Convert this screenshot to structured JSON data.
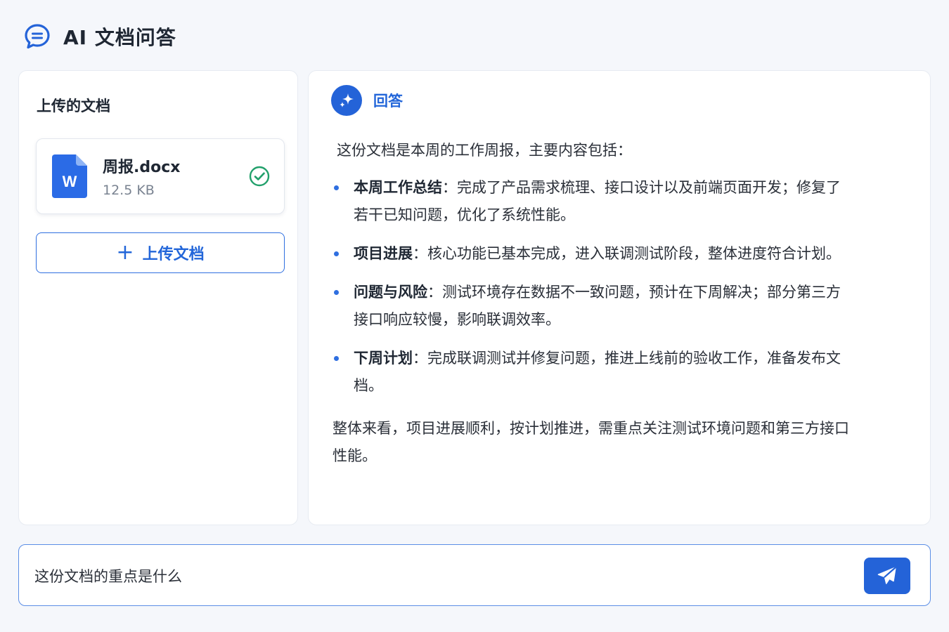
{
  "app": {
    "title": "AI 文档问答",
    "icon": "chat-bubble-icon",
    "accent_color": "#2463d8"
  },
  "sidebar": {
    "title": "上传的文档",
    "files": [
      {
        "name": "周报.docx",
        "size": "12.5 KB",
        "type_icon": "word-doc-icon",
        "type_letter": "W",
        "status": "uploaded",
        "status_icon": "check-circle-icon",
        "status_color": "#22a06b"
      }
    ],
    "upload_button": {
      "icon": "plus-icon",
      "icon_glyph": "+",
      "label": "上传文档"
    }
  },
  "answer": {
    "label": "回答",
    "icon": "sparkle-icon",
    "intro": "这份文档是本周的工作周报，主要内容包括：",
    "items": [
      {
        "title": "本周工作总结",
        "colon": "：",
        "text": "完成了产品需求梳理、接口设计以及前端页面开发；修复了若干已知问题，优化了系统性能。"
      },
      {
        "title": "项目进展",
        "colon": "：",
        "text": "核心功能已基本完成，进入联调测试阶段，整体进度符合计划。"
      },
      {
        "title": "问题与风险",
        "colon": "：",
        "text": "测试环境存在数据不一致问题，预计在下周解决；部分第三方接口响应较慢，影响联调效率。"
      },
      {
        "title": "下周计划",
        "colon": "：",
        "text": "完成联调测试并修复问题，推进上线前的验收工作，准备发布文档。"
      }
    ],
    "summary": "整体来看，项目进展顺利，按计划推进，需重点关注测试环境问题和第三方接口性能。"
  },
  "composer": {
    "value": "这份文档的重点是什么",
    "send_icon": "send-icon"
  }
}
